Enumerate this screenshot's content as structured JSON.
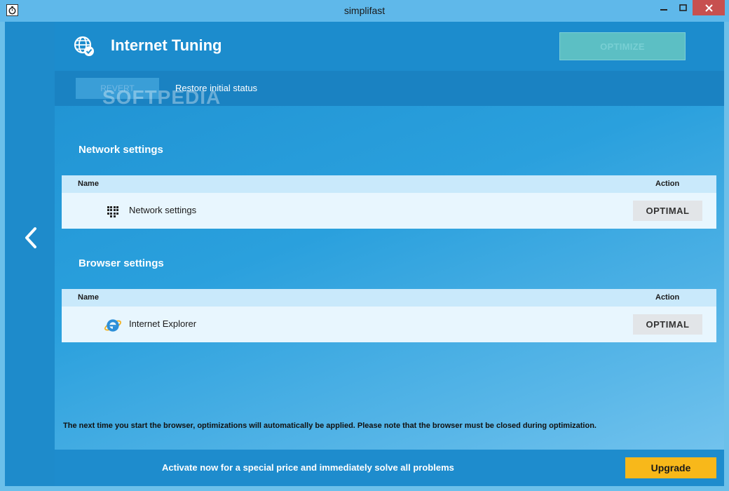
{
  "window": {
    "title": "simplifast"
  },
  "header": {
    "title": "Internet Tuning",
    "optimize_label": "OPTIMIZE",
    "icon": "globe-check-icon"
  },
  "subbar": {
    "revert_label": "REVERT",
    "restore_label": "Restore initial status",
    "watermark": "SOFTPEDIA"
  },
  "network": {
    "heading": "Network settings",
    "col_name": "Name",
    "col_action": "Action",
    "rows": [
      {
        "label": "Network settings",
        "action": "OPTIMAL",
        "icon": "network-grid-icon"
      }
    ]
  },
  "browser": {
    "heading": "Browser settings",
    "col_name": "Name",
    "col_action": "Action",
    "rows": [
      {
        "label": "Internet Explorer",
        "action": "OPTIMAL",
        "icon": "internet-explorer-icon"
      }
    ]
  },
  "note": "The next time you start the browser, optimizations will automatically be applied. Please note that the browser must be closed during optimization.",
  "footer": {
    "promo": "Activate now for a special price and immediately solve all problems",
    "upgrade_label": "Upgrade"
  },
  "colors": {
    "accent": "#1c8ccd",
    "upgrade": "#f8b81a",
    "close": "#c7504f"
  }
}
